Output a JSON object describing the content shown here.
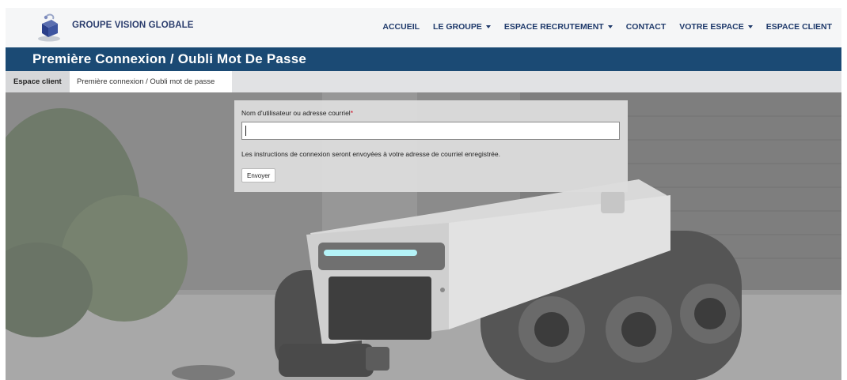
{
  "header": {
    "brand": "GROUPE VISION GLOBALE",
    "logo_icon": "cube-logo-icon",
    "menu": [
      {
        "label": "ACCUEIL",
        "dropdown": false
      },
      {
        "label": "LE GROUPE",
        "dropdown": true
      },
      {
        "label": "ESPACE RECRUTEMENT",
        "dropdown": true
      },
      {
        "label": "CONTACT",
        "dropdown": false
      },
      {
        "label": "VOTRE ESPACE",
        "dropdown": true
      },
      {
        "label": "ESPACE CLIENT",
        "dropdown": false
      }
    ]
  },
  "title": "Première Connexion / Oubli Mot De Passe",
  "breadcrumb": {
    "home": "Espace client",
    "current": "Première connexion / Oubli mot de passe"
  },
  "form": {
    "label": "Nom d'utilisateur ou adresse courriel",
    "required_mark": "*",
    "value": "",
    "help": "Les instructions de connexion seront envoyées à votre adresse de courriel enregistrée.",
    "submit": "Envoyer"
  },
  "colors": {
    "nav_text": "#1f3a6b",
    "title_band": "#1b4a74",
    "breadcrumb_bg": "#e1e2e4",
    "required": "#d0021b"
  }
}
